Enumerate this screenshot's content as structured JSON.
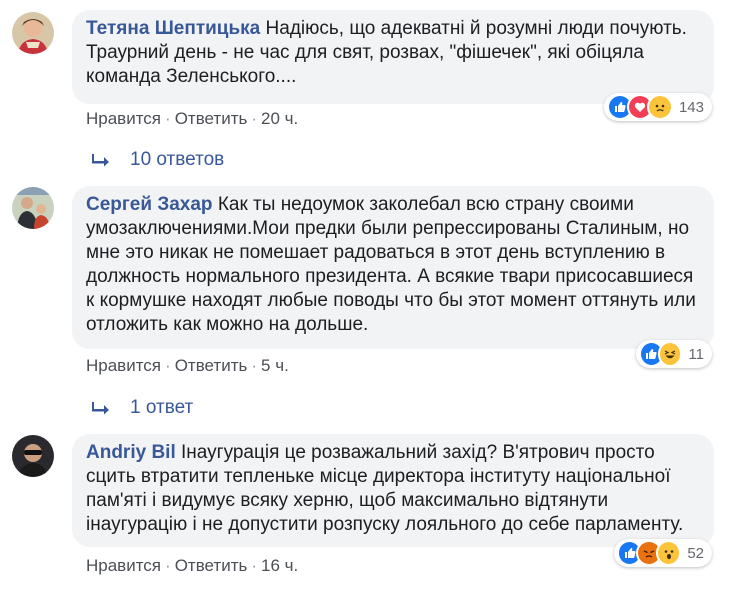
{
  "comments": [
    {
      "author": "Тетяна Шептицька",
      "text": "Надіюсь, що адекватні й розумні люди почують. Траурний день - не час для свят, розвах, \"фішечек\", які обіцяла команда Зеленського....",
      "reaction_count": "143",
      "reactions": [
        "like",
        "love",
        "sad"
      ],
      "like_label": "Нравится",
      "reply_label": "Ответить",
      "time": "20 ч.",
      "replies_label": "10 ответов"
    },
    {
      "author": "Сергей Захар",
      "text": "Как ты недоумок заколебал всю страну своими умозаключениями.Мои предки были репрессированы Сталиным, но мне это никак не помешает радоваться в этот день вступлению в должность нормального президента. А всякие твари присосавшиеся к кормушке находят любые поводы что бы этот момент оттянуть или отложить как можно на дольше.",
      "reaction_count": "11",
      "reactions": [
        "like",
        "haha"
      ],
      "like_label": "Нравится",
      "reply_label": "Ответить",
      "time": "5 ч.",
      "replies_label": "1 ответ"
    },
    {
      "author": "Andriy Bil",
      "text": "Інаугурація це розважальний захід? В'ятрович просто сцить втратити тепленьке місце директора інституту національної пам'яті і видумує всяку херню, щоб максимально відтянути інаугурацію і не допустити розпуску лояльного до себе парламенту.",
      "reaction_count": "52",
      "reactions": [
        "like",
        "angry",
        "wow"
      ],
      "like_label": "Нравится",
      "reply_label": "Ответить",
      "time": "16 ч."
    }
  ],
  "colors": {
    "author": "#385898",
    "bubble": "#f2f3f5",
    "like": "#1877f2",
    "love": "#f33e58",
    "emoji": "#fcc43a",
    "angry": "#e9710f"
  }
}
